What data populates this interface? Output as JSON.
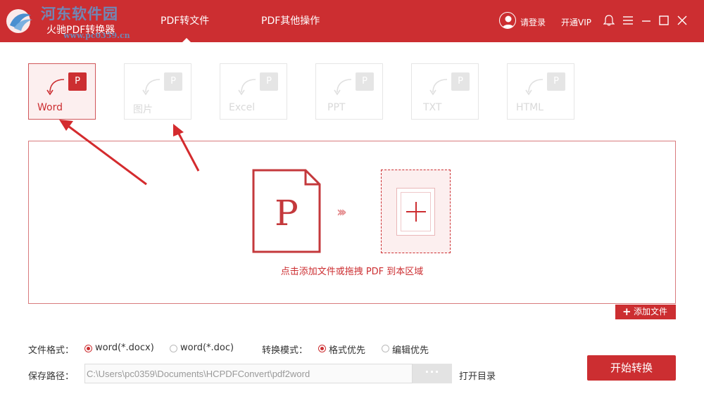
{
  "app": {
    "title": "火驰PDF转换器",
    "watermark_main": "河东软件园",
    "watermark_sub": "www.pc0359.cn"
  },
  "nav": {
    "tabs": [
      {
        "label": "PDF转文件",
        "active": true
      },
      {
        "label": "PDF其他操作",
        "active": false
      }
    ]
  },
  "header": {
    "login_label": "请登录",
    "vip_label": "开通VIP",
    "icons": [
      "user-icon",
      "skin-icon",
      "menu-icon",
      "minimize-icon",
      "maximize-icon",
      "close-icon"
    ]
  },
  "formats": {
    "badge": "P",
    "items": [
      {
        "label": "Word",
        "active": true
      },
      {
        "label": "图片",
        "active": false
      },
      {
        "label": "Excel",
        "active": false
      },
      {
        "label": "PPT",
        "active": false
      },
      {
        "label": "TXT",
        "active": false
      },
      {
        "label": "HTML",
        "active": false
      }
    ]
  },
  "dropzone": {
    "doc_letter": "P",
    "chevrons": "›››",
    "hint": "点击添加文件或拖拽 PDF 到本区域"
  },
  "add_file": {
    "icon": "+",
    "label": "添加文件"
  },
  "options": {
    "format_label": "文件格式：",
    "format_options": [
      {
        "label": "word(*.docx)",
        "selected": true
      },
      {
        "label": "word(*.doc)",
        "selected": false
      }
    ],
    "mode_label": "转换模式：",
    "mode_options": [
      {
        "label": "格式优先",
        "selected": true
      },
      {
        "label": "编辑优先",
        "selected": false
      }
    ],
    "path_label": "保存路径：",
    "path_value": "C:\\Users\\pc0359\\Documents\\HCPDFConvert\\pdf2word",
    "browse_label": "···",
    "open_dir_label": "打开目录",
    "start_label": "开始转换"
  },
  "colors": {
    "brand": "#cc2e31",
    "light": "#fcefef",
    "annotation": "#d42b2e"
  }
}
